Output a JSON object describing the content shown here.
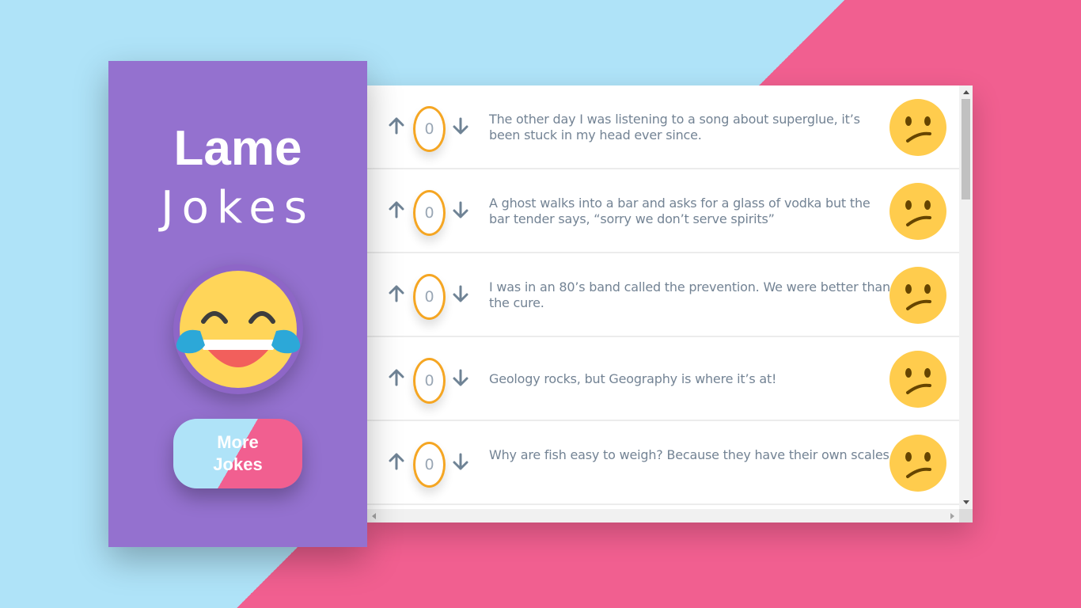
{
  "app": {
    "title_line1": "Lame",
    "title_line2": "Jokes",
    "more_button": {
      "line1": "More",
      "line2": "Jokes"
    },
    "main_emoji_icon": "face-with-tears-of-joy-icon"
  },
  "colors": {
    "background_left": "#afe3f8",
    "background_right": "#f15f90",
    "sidebar": "#9471cf",
    "score_border": "#f5a623",
    "vote_arrow": "#6f8395",
    "joke_text": "#738394",
    "face_yellow": "#ffcc4d"
  },
  "jokes": [
    {
      "score": "0",
      "text": "The other day I was listening to a song about superglue, it’s been stuck in my head ever since.",
      "reaction_icon": "confused-face-icon"
    },
    {
      "score": "0",
      "text": "A ghost walks into a bar and asks for a glass of vodka but the bar tender says, “sorry we don’t serve spirits”",
      "reaction_icon": "confused-face-icon"
    },
    {
      "score": "0",
      "text": "I was in an 80’s band called the prevention. We were better than the cure.",
      "reaction_icon": "confused-face-icon"
    },
    {
      "score": "0",
      "text": "Geology rocks, but Geography is where it’s at!",
      "reaction_icon": "confused-face-icon"
    },
    {
      "score": "0",
      "text": "Why are fish easy to weigh? Because they have their own scales.",
      "reaction_icon": "confused-face-icon"
    }
  ]
}
